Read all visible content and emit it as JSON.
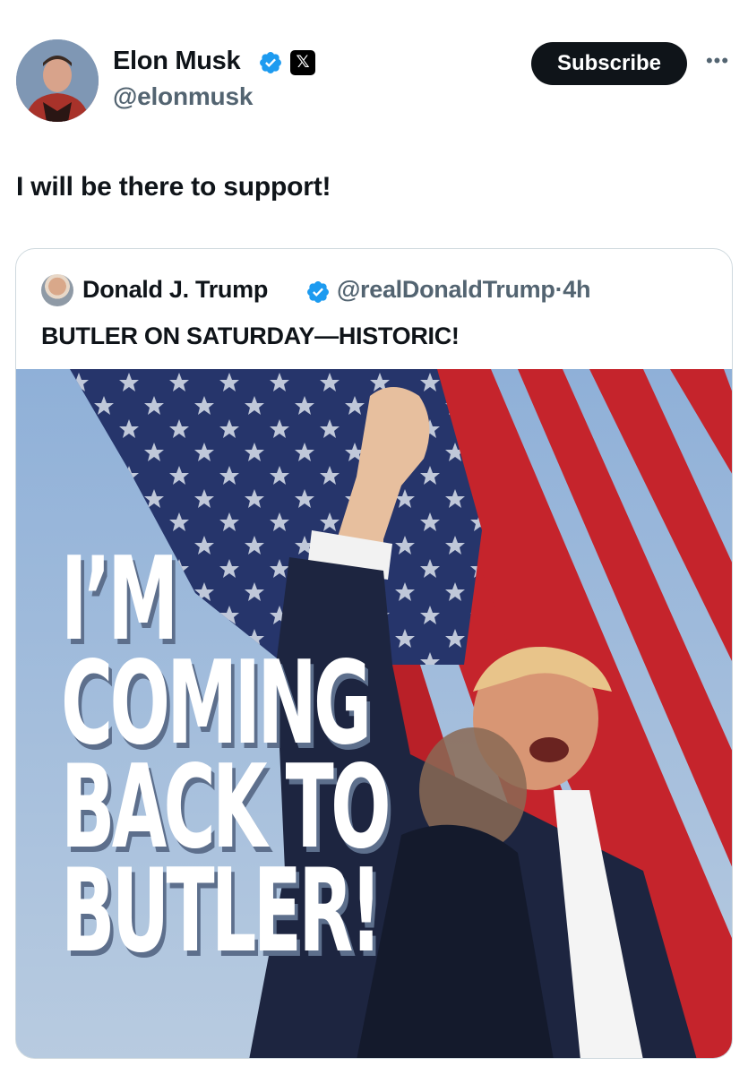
{
  "post": {
    "author_name": "Elon Musk",
    "author_handle": "@elonmusk",
    "subscribe_label": "Subscribe",
    "more_label": "•••",
    "x_badge": "𝕏",
    "text": "I will be there to support!"
  },
  "quoted": {
    "author_name": "Donald J. Trump",
    "author_handle": "@realDonaldTrump·4h",
    "text": "BUTLER ON SATURDAY—HISTORIC!",
    "image": {
      "headline_lines": [
        "I’M",
        "COMING",
        "BACK TO",
        "BUTLER!"
      ]
    }
  },
  "colors": {
    "verified": "#1d9bf0",
    "text_primary": "#0f1419",
    "text_secondary": "#536471",
    "border": "#cfd9de"
  },
  "icons": [
    "verified-badge-icon",
    "x-logo-icon",
    "more-options-icon"
  ]
}
